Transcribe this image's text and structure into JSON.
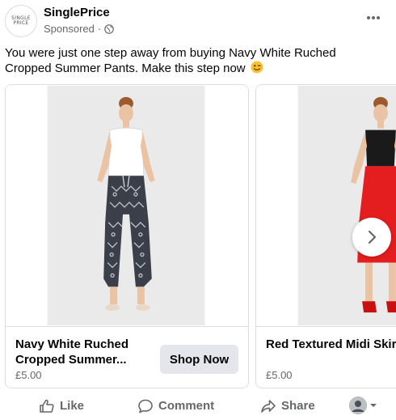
{
  "post": {
    "page_name": "SinglePrice",
    "logo_text_line1": "SINGLE",
    "logo_text_line2": "PRICE",
    "sponsored_label": "Sponsored",
    "separator": "·",
    "body_text": "You were just one step away from buying Navy White Ruched Cropped Summer Pants. Make this step now"
  },
  "cards": [
    {
      "title": "Navy White Ruched Cropped Summer...",
      "price": "£5.00",
      "cta_label": "Shop Now",
      "image_desc_icon": "product-photo-pants"
    },
    {
      "title": "Red Textured Midi Skirt",
      "price": "£5.00",
      "image_desc_icon": "product-photo-skirt"
    }
  ],
  "actions": {
    "like_label": "Like",
    "comment_label": "Comment",
    "share_label": "Share"
  },
  "colors": {
    "secondary_text": "#65676b",
    "button_bg": "#e4e6eb",
    "border": "#dadde1",
    "skirt_red": "#e41e1e"
  }
}
